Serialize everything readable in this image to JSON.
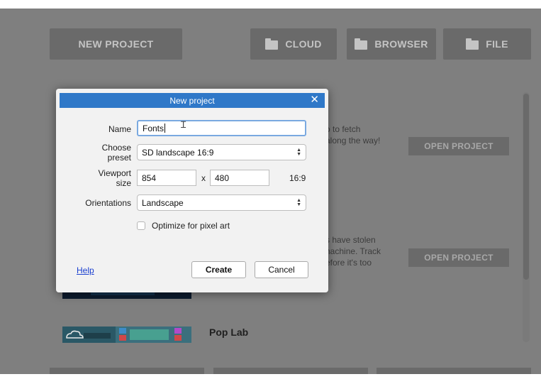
{
  "toolbar": {
    "new_project": "NEW PROJECT",
    "cloud": "CLOUD",
    "browser": "BROWSER",
    "file": "FILE"
  },
  "background": {
    "project1_text": "o to fetch\nalong the way!",
    "project2_text": "s have stolen\nnachine. Track\nefore it's too",
    "open_project_label": "OPEN PROJECT",
    "project3_name": "Pop Lab"
  },
  "dialog": {
    "title": "New project",
    "name_label": "Name",
    "name_value": "Fonts",
    "preset_label": "Choose\npreset",
    "preset_value": "SD landscape 16:9",
    "viewport_label": "Viewport\nsize",
    "viewport_width": "854",
    "viewport_sep": "x",
    "viewport_height": "480",
    "aspect": "16:9",
    "orientations_label": "Orientations",
    "orientations_value": "Landscape",
    "pixel_art_label": "Optimize for pixel art",
    "help": "Help",
    "create": "Create",
    "cancel": "Cancel"
  },
  "colors": {
    "title_bar": "#2f78c8",
    "overlay": "#7f7f7f",
    "focus_ring": "#7aa9e0"
  }
}
